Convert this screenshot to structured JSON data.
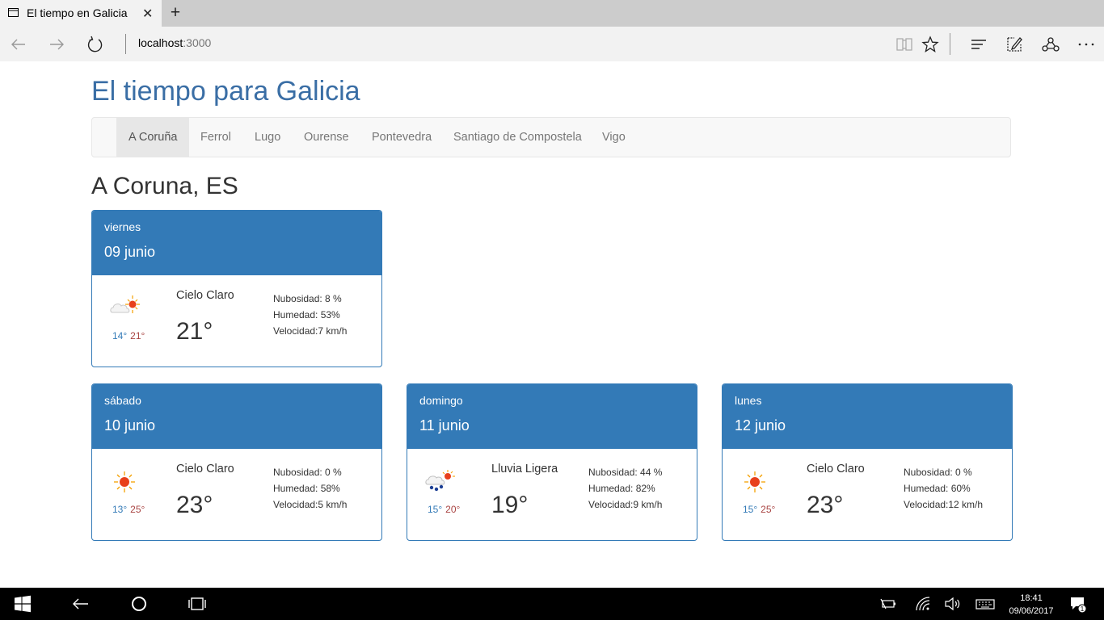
{
  "browser": {
    "tab_title": "El tiempo en Galicia",
    "address_host": "localhost",
    "address_port": ":3000"
  },
  "page": {
    "title": "El tiempo para Galicia",
    "nav": [
      "A Coruña",
      "Ferrol",
      "Lugo",
      "Ourense",
      "Pontevedra",
      "Santiago de Compostela",
      "Vigo"
    ],
    "active_nav": "A Coruña",
    "city": "A Coruna, ES"
  },
  "forecast": [
    {
      "day": "viernes",
      "date": "09 junio",
      "icon": "partly-cloudy-sun-icon",
      "min": "14°",
      "max": "21°",
      "desc": "Cielo Claro",
      "temp": "21°",
      "nubosidad": "Nubosidad: 8 %",
      "humedad": "Humedad: 53%",
      "velocidad": "Velocidad:7 km/h"
    },
    {
      "day": "sábado",
      "date": "10 junio",
      "icon": "sun-icon",
      "min": "13°",
      "max": "25°",
      "desc": "Cielo Claro",
      "temp": "23°",
      "nubosidad": "Nubosidad: 0 %",
      "humedad": "Humedad: 58%",
      "velocidad": "Velocidad:5 km/h"
    },
    {
      "day": "domingo",
      "date": "11 junio",
      "icon": "light-rain-icon",
      "min": "15°",
      "max": "20°",
      "desc": "Lluvia Ligera",
      "temp": "19°",
      "nubosidad": "Nubosidad: 44 %",
      "humedad": "Humedad: 82%",
      "velocidad": "Velocidad:9 km/h"
    },
    {
      "day": "lunes",
      "date": "12 junio",
      "icon": "sun-icon",
      "min": "15°",
      "max": "25°",
      "desc": "Cielo Claro",
      "temp": "23°",
      "nubosidad": "Nubosidad: 0 %",
      "humedad": "Humedad: 60%",
      "velocidad": "Velocidad:12 km/h"
    }
  ],
  "taskbar": {
    "time": "18:41",
    "date": "09/06/2017",
    "notifications": "1"
  },
  "colors": {
    "accent": "#337ab7",
    "title": "#3a6ea5",
    "max_temp": "#a94442"
  }
}
